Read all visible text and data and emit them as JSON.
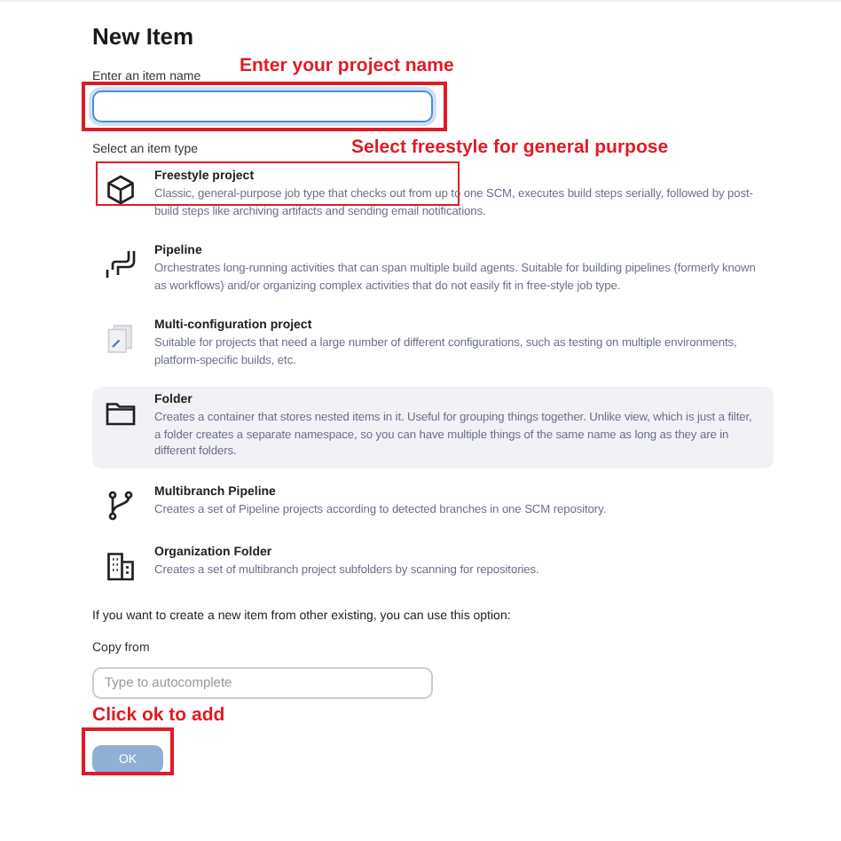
{
  "title": "New Item",
  "name_field": {
    "label": "Enter an item name",
    "focused": true,
    "annotation": "Enter your project name"
  },
  "type_section": {
    "label": "Select an item type",
    "annotation": "Select freestyle for general purpose"
  },
  "item_types": [
    {
      "kind": "cube",
      "name": "Freestyle project",
      "description": "Classic, general-purpose job type that checks out from up to one SCM, executes build steps serially, followed by post-build steps like archiving artifacts and sending email notifications.",
      "highlighted": false,
      "marked": true
    },
    {
      "kind": "pipeline",
      "name": "Pipeline",
      "description": "Orchestrates long-running activities that can span multiple build agents. Suitable for building pipelines (formerly known as workflows) and/or organizing complex activities that do not easily fit in free-style job type.",
      "highlighted": false,
      "marked": false
    },
    {
      "kind": "multiconfig",
      "name": "Multi-configuration project",
      "description": "Suitable for projects that need a large number of different configurations, such as testing on multiple environments, platform-specific builds, etc.",
      "highlighted": false,
      "marked": false
    },
    {
      "kind": "folder",
      "name": "Folder",
      "description": "Creates a container that stores nested items in it. Useful for grouping things together. Unlike view, which is just a filter, a folder creates a separate namespace, so you can have multiple things of the same name as long as they are in different folders.",
      "highlighted": true,
      "marked": false
    },
    {
      "kind": "branch",
      "name": "Multibranch Pipeline",
      "description": "Creates a set of Pipeline projects according to detected branches in one SCM repository.",
      "highlighted": false,
      "marked": false
    },
    {
      "kind": "building",
      "name": "Organization Folder",
      "description": "Creates a set of multibranch project subfolders by scanning for repositories.",
      "highlighted": false,
      "marked": false
    }
  ],
  "copy_note": "If you want to create a new item from other existing, you can use this option:",
  "copy_field": {
    "label": "Copy from",
    "placeholder": "Type to autocomplete",
    "annotation": "Click ok to add"
  },
  "ok_button": {
    "label": "OK",
    "disabled": true
  }
}
